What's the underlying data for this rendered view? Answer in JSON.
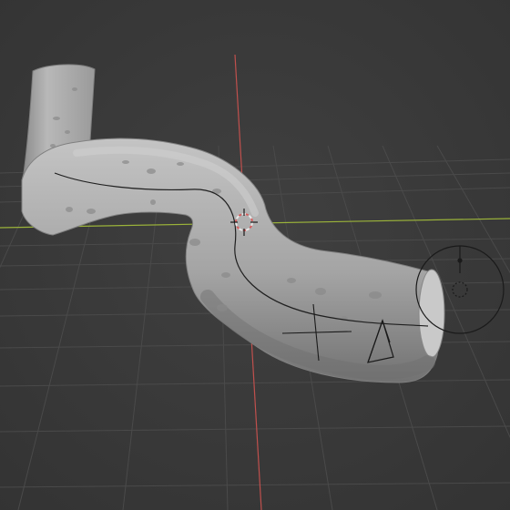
{
  "viewport": {
    "background": "#3a3a3a",
    "grid_color": "#4a4a4a",
    "x_axis_color": "#9bb33a",
    "y_axis_color": "#c0504d"
  },
  "scene": {
    "object_color": "#a8a8a8",
    "object_shadow": "#6f6f6f",
    "object_highlight": "#c8c8c8",
    "curve_color": "#222222",
    "cursor_color": "#e8e8e8",
    "cursor_accent": "#d65c5c",
    "icons": [
      "3d-cursor-icon",
      "camera-icon",
      "light-icon",
      "empty-axes-icon"
    ]
  }
}
